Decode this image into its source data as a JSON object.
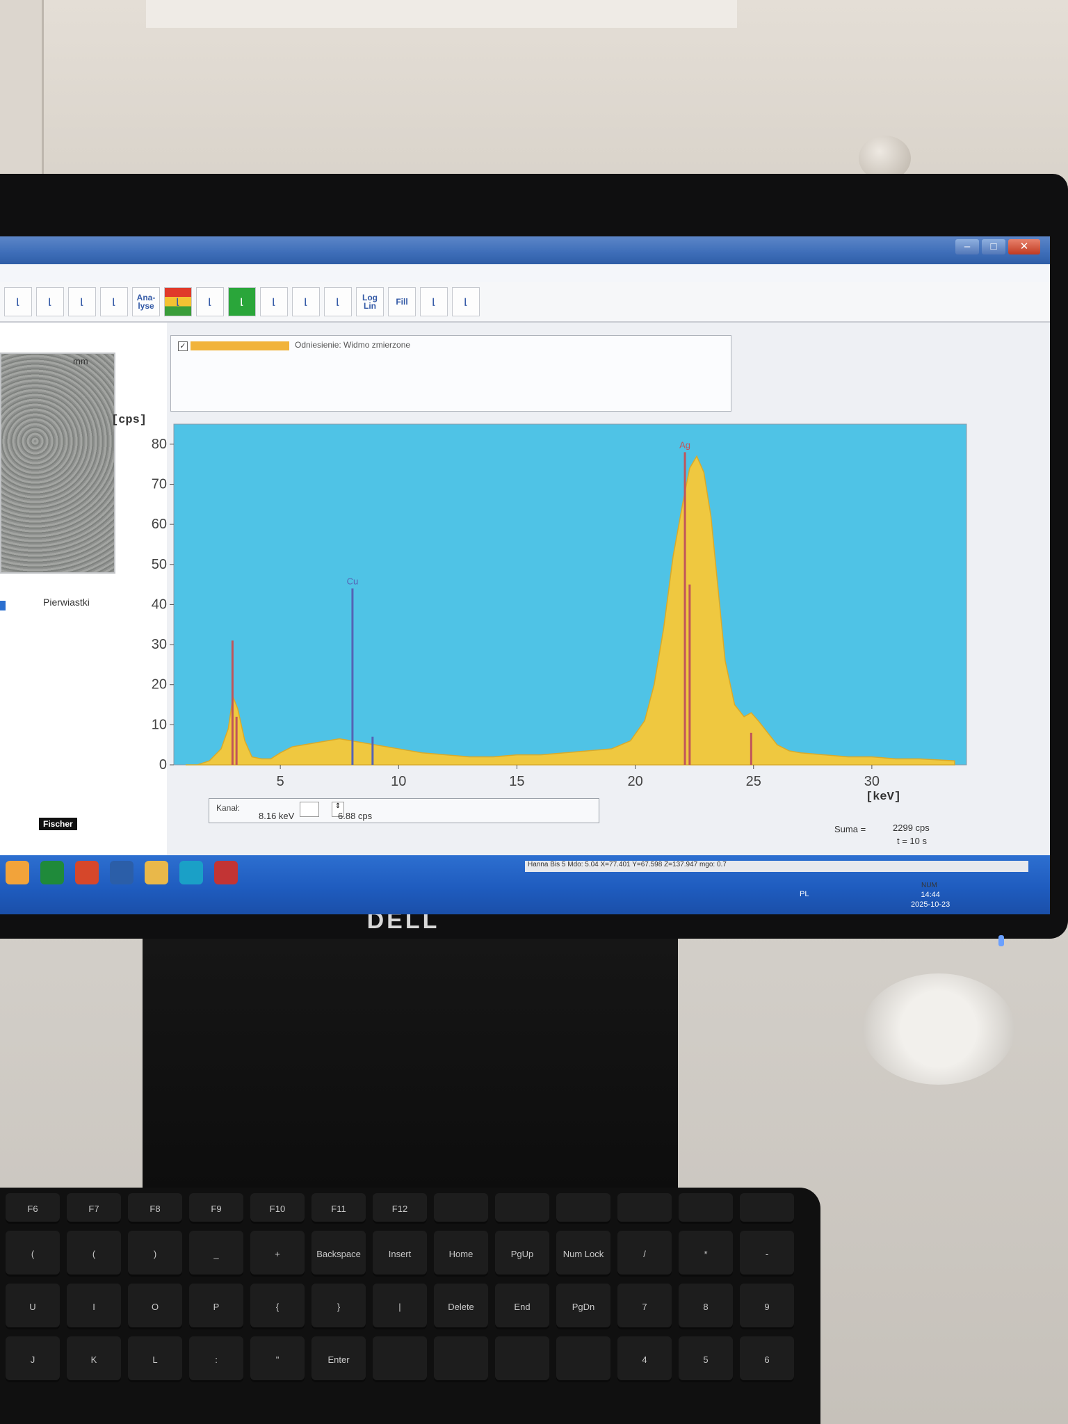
{
  "window": {
    "min_label": "–",
    "max_label": "□",
    "close_label": "✕"
  },
  "toolbar": {
    "buttons": [
      {
        "name": "print",
        "label": "",
        "icon": "print-icon"
      },
      {
        "name": "sample-view",
        "label": "",
        "icon": "sample-icon"
      },
      {
        "name": "spectrum-small",
        "label": "",
        "icon": "spectrum-icon"
      },
      {
        "name": "zoom",
        "label": "",
        "icon": "zoom-icon"
      },
      {
        "name": "analysis",
        "label": "Ana-\nlyse",
        "icon": ""
      },
      {
        "name": "layers",
        "label": "",
        "icon": "layers-icon"
      },
      {
        "name": "settings",
        "label": "",
        "icon": "tools-icon"
      },
      {
        "name": "spectrum-active",
        "label": "",
        "icon": "spectrum-green-icon"
      },
      {
        "name": "spectrum-lines",
        "label": "",
        "icon": "lines-icon"
      },
      {
        "name": "spectrum-compare",
        "label": "",
        "icon": "compare-icon"
      },
      {
        "name": "spectrum-axis",
        "label": "",
        "icon": "axis-icon"
      },
      {
        "name": "log-lin",
        "label": "Log\nLin",
        "icon": ""
      },
      {
        "name": "fill",
        "label": "Fill",
        "icon": ""
      },
      {
        "name": "exit",
        "label": "",
        "icon": "door-icon"
      },
      {
        "name": "calibrate",
        "label": "",
        "icon": "calibrate-icon"
      }
    ]
  },
  "left_panel": {
    "unit": "mm",
    "elements_label": "Pierwiastki",
    "logo": "Fischer"
  },
  "legend": {
    "checked": "✓",
    "text": "Odniesienie: Widmo zmierzone",
    "color": "#f1b33a"
  },
  "colors": {
    "plot_bg": "#4fc3e6",
    "spectrum": "#efc840",
    "line_ag": "#c0555a",
    "line_cu": "#5563b5"
  },
  "chart_data": {
    "type": "area",
    "ylabel": "[cps]",
    "xlabel": "[keV]",
    "xlim": [
      0.5,
      34
    ],
    "ylim": [
      0,
      85
    ],
    "yticks": [
      0,
      10,
      20,
      30,
      40,
      50,
      60,
      70,
      80
    ],
    "xticks": [
      5,
      10,
      15,
      20,
      25,
      30
    ],
    "grid": false,
    "series": [
      {
        "x": [
          1.0,
          1.5,
          2.0,
          2.5,
          2.8,
          3.0,
          3.2,
          3.5,
          3.8,
          4.2,
          4.6,
          5.0,
          5.5,
          6.0,
          6.5,
          7.0,
          7.5,
          8.0,
          8.5,
          9.0,
          10.0,
          11.0,
          12.0,
          13.0,
          14.0,
          15.0,
          16.0,
          17.0,
          18.0,
          19.0,
          19.8,
          20.4,
          20.8,
          21.2,
          21.6,
          22.0,
          22.3,
          22.6,
          22.9,
          23.2,
          23.5,
          23.8,
          24.2,
          24.6,
          24.9,
          25.2,
          25.6,
          26.0,
          26.5,
          27.0,
          28.0,
          29.0,
          30.0,
          31.0,
          32.0,
          33.5
        ],
        "y": [
          0,
          0,
          1,
          4,
          9,
          17,
          14,
          6,
          2,
          1.5,
          1.5,
          3,
          4.5,
          5,
          5.5,
          6,
          6.5,
          6,
          5.5,
          5,
          4,
          3,
          2.5,
          2,
          2,
          2.5,
          2.5,
          3,
          3.5,
          4,
          6,
          11,
          20,
          34,
          52,
          65,
          74,
          77,
          73,
          62,
          44,
          26,
          15,
          12,
          13,
          11,
          8,
          5,
          3.5,
          3,
          2.5,
          2,
          2,
          1.5,
          1.5,
          1
        ]
      }
    ],
    "element_lines": [
      {
        "element": "",
        "x": 2.98,
        "y": 31,
        "color": "#c0555a"
      },
      {
        "element": "",
        "x": 3.15,
        "y": 12,
        "color": "#c0555a"
      },
      {
        "element": "Cu",
        "x": 8.05,
        "y": 44,
        "color": "#5563b5"
      },
      {
        "element": "",
        "x": 8.9,
        "y": 7,
        "color": "#5563b5"
      },
      {
        "element": "Ag",
        "x": 22.1,
        "y": 78,
        "color": "#c0555a"
      },
      {
        "element": "",
        "x": 22.3,
        "y": 45,
        "color": "#c0555a"
      },
      {
        "element": "",
        "x": 24.9,
        "y": 8,
        "color": "#c0555a"
      }
    ]
  },
  "info": {
    "kanal_label": "Kanał:",
    "kev_value": "8.16 keV",
    "cps_value": "6.88 cps",
    "suma_label": "Suma =",
    "suma_value": "2299 cps",
    "time_value": "t = 10 s"
  },
  "statusbar": {
    "text": "Hanna Bis 5  Mdo: 5.04  X=77.401  Y=67.598  Z=137.947  mgo: 0.7",
    "num": "NUM"
  },
  "taskbar": {
    "lang": "PL",
    "time": "14:44",
    "date": "2025-10-23",
    "apps": [
      "media-player-icon",
      "excel-icon",
      "powerpoint-icon",
      "word-icon",
      "chrome-icon",
      "edge-icon",
      "xray-app-icon"
    ]
  },
  "monitor": {
    "brand": "DELL"
  },
  "keyboard": {
    "row1": [
      "F6",
      "F7",
      "F8",
      "F9",
      "F10",
      "F11",
      "F12",
      "",
      "",
      "",
      "",
      "",
      ""
    ],
    "row2": [
      "(",
      "(",
      ")",
      "_",
      "+",
      "Backspace",
      "Insert",
      "Home",
      "PgUp",
      "Num Lock",
      "/",
      "*",
      "-"
    ],
    "row3": [
      "U",
      "I",
      "O",
      "P",
      "{",
      "}",
      "|",
      "Delete",
      "End",
      "PgDn",
      "7",
      "8",
      "9"
    ],
    "row4": [
      "J",
      "K",
      "L",
      ":",
      "\"",
      "Enter",
      "",
      "",
      "",
      "",
      "4",
      "5",
      "6"
    ]
  }
}
